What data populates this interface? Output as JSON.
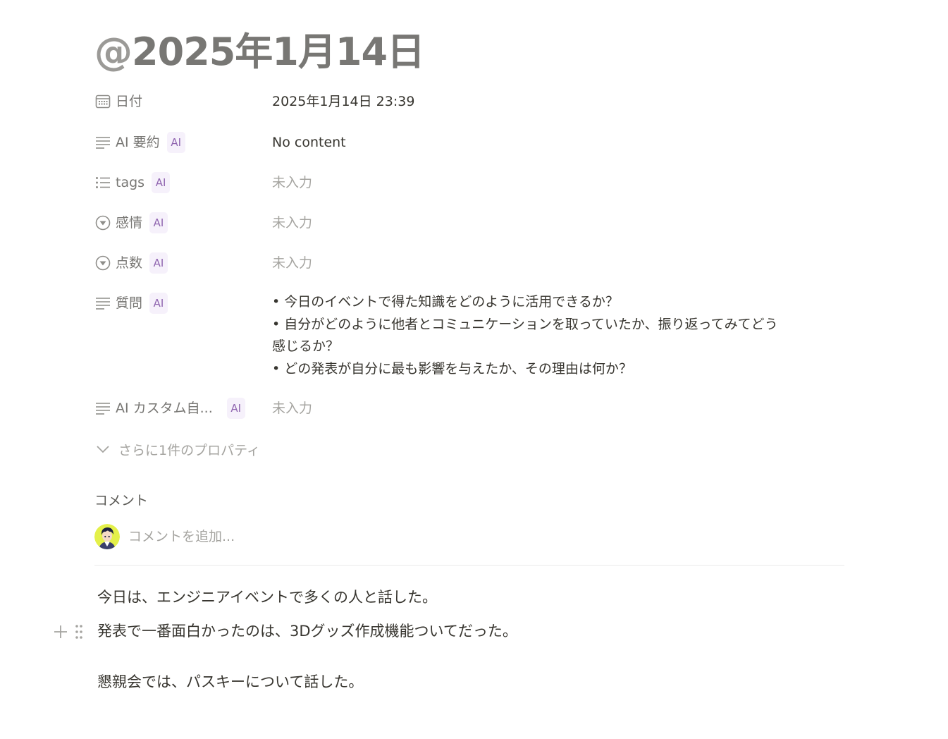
{
  "page": {
    "title_at": "@",
    "title_text": "2025年1月14日"
  },
  "properties": [
    {
      "name": "日付",
      "icon": "calendar-icon",
      "ai": false,
      "value": "2025年1月14日 23:39",
      "empty": false
    },
    {
      "name": "AI 要約",
      "icon": "text-lines-icon",
      "ai": true,
      "ai_label": "AI",
      "value": "No content",
      "empty": false
    },
    {
      "name": "tags",
      "icon": "list-icon",
      "ai": true,
      "ai_label": "AI",
      "value": "未入力",
      "empty": true
    },
    {
      "name": "感情",
      "icon": "select-circle-icon",
      "ai": true,
      "ai_label": "AI",
      "value": "未入力",
      "empty": true
    },
    {
      "name": "点数",
      "icon": "select-circle-icon",
      "ai": true,
      "ai_label": "AI",
      "value": "未入力",
      "empty": true
    },
    {
      "name": "質問",
      "icon": "text-lines-icon",
      "ai": true,
      "ai_label": "AI",
      "items": [
        "• 今日のイベントで得た知識をどのように活用できるか？",
        "• 自分がどのように他者とコミュニケーションを取っていたか、振り返ってみてどう",
        "感じるか？",
        "• どの発表が自分に最も影響を与えたか、その理由は何か？"
      ]
    },
    {
      "name": "AI カスタム自...",
      "icon": "text-lines-icon",
      "ai": true,
      "ai_label": "AI",
      "value": "未入力",
      "empty": true
    }
  ],
  "more_properties": "さらに1件のプロパティ",
  "comments": {
    "heading": "コメント",
    "placeholder": "コメントを追加..."
  },
  "body": [
    "今日は、エンジニアイベントで多くの人と話した。",
    "発表で一番面白かったのは、3Dグッズ作成機能ついてだった。",
    "懇親会では、パスキーについて話した。"
  ],
  "colors": {
    "title": "#787774",
    "label": "#787774",
    "empty": "#a5a4a0",
    "ai_badge_bg": "#f6f1fb",
    "ai_badge_text": "#9065b0",
    "avatar_bg": "#e4f04a"
  }
}
